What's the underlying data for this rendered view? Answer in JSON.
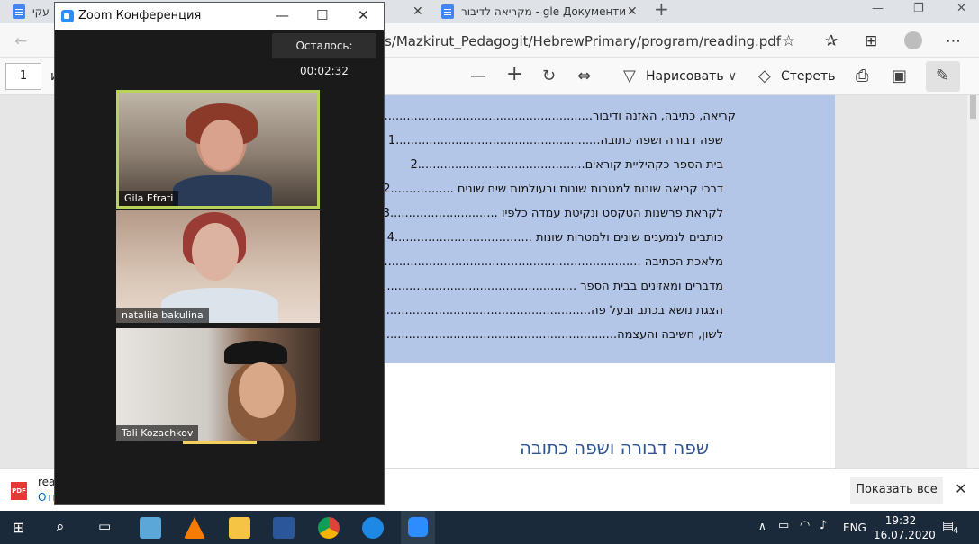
{
  "browser": {
    "tabs": [
      {
        "label": "עקי"
      },
      {
        "label": "מקריאה לדיבור - gle Документи"
      }
    ],
    "address": "s/Mazkirut_Pedagogit/HebrewPrimary/program/reading.pdf"
  },
  "pdf_toolbar": {
    "page": "1",
    "left_label": "и",
    "draw_label": "Нарисовать",
    "erase_label": "Стереть"
  },
  "document": {
    "toc": [
      {
        "text": "קריאה, כתיבה, האזנה ודיבור..........................................................1"
      },
      {
        "text": "שפה דבורה ושפה כתובה.......................................................1"
      },
      {
        "text": "בית הספר כקהיליית קוראים.............................................2"
      },
      {
        "text": "דרכי קריאה שונות למטרות שונות ובעולמות שיח שונים .................2"
      },
      {
        "text": "לקראת פרשנות הטקסט ונקיטת עמדה כלפיו .............................3"
      },
      {
        "text": "כותבים לנמענים שונים ולמטרות שונות .....................................4"
      },
      {
        "text": "מלאכת הכתיבה ..............................................................................5"
      },
      {
        "text": "מדברים ומאזינים בבית הספר ...........................................................5"
      },
      {
        "text": "הצגת נושא בכתב ובעל פה.................................................................6"
      },
      {
        "text": "לשון, חשיבה והעצמה.........................................................................7"
      }
    ],
    "heading": "שפה דבורה ושפה כתובה"
  },
  "downloads": {
    "file_name": "rea",
    "open_label": "Отк",
    "show_all": "Показать все"
  },
  "zoom": {
    "title": "Zoom Конференция",
    "timer": "Осталось: 00:02:32",
    "participants": [
      {
        "name": "Gila Efrati"
      },
      {
        "name": "nataliia bakulina"
      },
      {
        "name": "Tali Kozachkov"
      }
    ]
  },
  "taskbar": {
    "lang": "ENG",
    "time": "19:32",
    "date": "16.07.2020",
    "notifications": "4"
  }
}
